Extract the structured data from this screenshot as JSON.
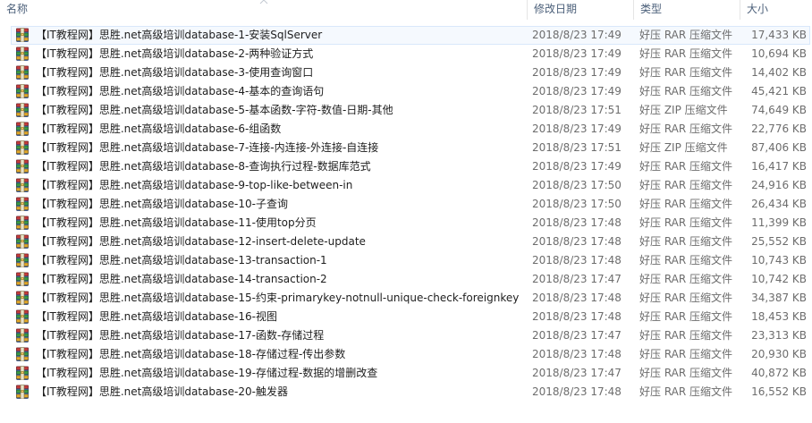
{
  "columns": {
    "name": "名称",
    "date": "修改日期",
    "type": "类型",
    "size": "大小"
  },
  "files": [
    {
      "name": "【IT教程网】思胜.net高级培训database-1-安装SqlServer",
      "date": "2018/8/23 17:49",
      "type": "好压 RAR 压缩文件",
      "size": "17,433 KB",
      "icon": "rar-archive-icon"
    },
    {
      "name": "【IT教程网】思胜.net高级培训database-2-两种验证方式",
      "date": "2018/8/23 17:49",
      "type": "好压 RAR 压缩文件",
      "size": "10,694 KB",
      "icon": "rar-archive-icon"
    },
    {
      "name": "【IT教程网】思胜.net高级培训database-3-使用查询窗口",
      "date": "2018/8/23 17:49",
      "type": "好压 RAR 压缩文件",
      "size": "14,402 KB",
      "icon": "rar-archive-icon"
    },
    {
      "name": "【IT教程网】思胜.net高级培训database-4-基本的查询语句",
      "date": "2018/8/23 17:49",
      "type": "好压 RAR 压缩文件",
      "size": "45,421 KB",
      "icon": "rar-archive-icon"
    },
    {
      "name": "【IT教程网】思胜.net高级培训database-5-基本函数-字符-数值-日期-其他",
      "date": "2018/8/23 17:51",
      "type": "好压 ZIP 压缩文件",
      "size": "74,649 KB",
      "icon": "zip-archive-icon"
    },
    {
      "name": "【IT教程网】思胜.net高级培训database-6-组函数",
      "date": "2018/8/23 17:49",
      "type": "好压 RAR 压缩文件",
      "size": "22,776 KB",
      "icon": "rar-archive-icon"
    },
    {
      "name": "【IT教程网】思胜.net高级培训database-7-连接-内连接-外连接-自连接",
      "date": "2018/8/23 17:51",
      "type": "好压 ZIP 压缩文件",
      "size": "87,406 KB",
      "icon": "zip-archive-icon"
    },
    {
      "name": "【IT教程网】思胜.net高级培训database-8-查询执行过程-数据库范式",
      "date": "2018/8/23 17:49",
      "type": "好压 RAR 压缩文件",
      "size": "16,417 KB",
      "icon": "rar-archive-icon"
    },
    {
      "name": "【IT教程网】思胜.net高级培训database-9-top-like-between-in",
      "date": "2018/8/23 17:50",
      "type": "好压 RAR 压缩文件",
      "size": "24,916 KB",
      "icon": "rar-archive-icon"
    },
    {
      "name": "【IT教程网】思胜.net高级培训database-10-子查询",
      "date": "2018/8/23 17:50",
      "type": "好压 RAR 压缩文件",
      "size": "26,434 KB",
      "icon": "rar-archive-icon"
    },
    {
      "name": "【IT教程网】思胜.net高级培训database-11-使用top分页",
      "date": "2018/8/23 17:48",
      "type": "好压 RAR 压缩文件",
      "size": "11,399 KB",
      "icon": "rar-archive-icon"
    },
    {
      "name": "【IT教程网】思胜.net高级培训database-12-insert-delete-update",
      "date": "2018/8/23 17:48",
      "type": "好压 RAR 压缩文件",
      "size": "25,552 KB",
      "icon": "rar-archive-icon"
    },
    {
      "name": "【IT教程网】思胜.net高级培训database-13-transaction-1",
      "date": "2018/8/23 17:48",
      "type": "好压 RAR 压缩文件",
      "size": "10,743 KB",
      "icon": "rar-archive-icon"
    },
    {
      "name": "【IT教程网】思胜.net高级培训database-14-transaction-2",
      "date": "2018/8/23 17:47",
      "type": "好压 RAR 压缩文件",
      "size": "10,742 KB",
      "icon": "rar-archive-icon"
    },
    {
      "name": "【IT教程网】思胜.net高级培训database-15-约束-primarykey-notnull-unique-check-foreignkey",
      "date": "2018/8/23 17:48",
      "type": "好压 RAR 压缩文件",
      "size": "34,387 KB",
      "icon": "rar-archive-icon"
    },
    {
      "name": "【IT教程网】思胜.net高级培训database-16-视图",
      "date": "2018/8/23 17:48",
      "type": "好压 RAR 压缩文件",
      "size": "18,453 KB",
      "icon": "rar-archive-icon"
    },
    {
      "name": "【IT教程网】思胜.net高级培训database-17-函数-存储过程",
      "date": "2018/8/23 17:47",
      "type": "好压 RAR 压缩文件",
      "size": "23,313 KB",
      "icon": "rar-archive-icon"
    },
    {
      "name": "【IT教程网】思胜.net高级培训database-18-存储过程-传出参数",
      "date": "2018/8/23 17:48",
      "type": "好压 RAR 压缩文件",
      "size": "20,930 KB",
      "icon": "rar-archive-icon"
    },
    {
      "name": "【IT教程网】思胜.net高级培训database-19-存储过程-数据的增删改查",
      "date": "2018/8/23 17:47",
      "type": "好压 RAR 压缩文件",
      "size": "40,872 KB",
      "icon": "rar-archive-icon"
    },
    {
      "name": "【IT教程网】思胜.net高级培训database-20-触发器",
      "date": "2018/8/23 17:48",
      "type": "好压 RAR 压缩文件",
      "size": "16,552 KB",
      "icon": "rar-archive-icon"
    }
  ],
  "selected_index": 0,
  "colors": {
    "header_text": "#4c607a",
    "selection_border": "#d9e8fb",
    "selection_fill": "#f5f9fe",
    "secondary_text": "#6d6d6d"
  }
}
